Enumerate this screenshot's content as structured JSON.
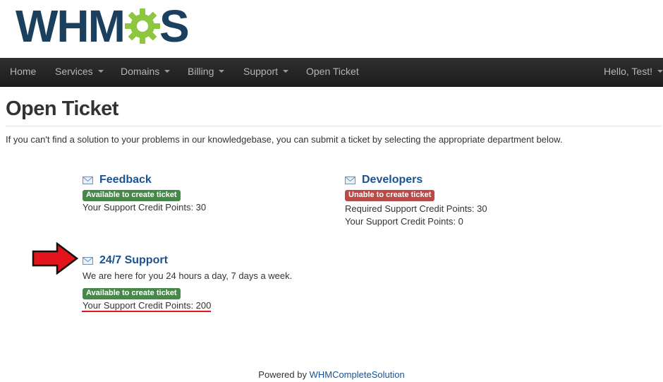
{
  "brand": {
    "logo_text_left": "WHM",
    "logo_text_right": "S",
    "logo_text_color": "#1b3f5e",
    "gear_color": "#8dc63f",
    "gear_icon": "gear-icon"
  },
  "nav": {
    "items": [
      {
        "label": "Home",
        "dropdown": false
      },
      {
        "label": "Services",
        "dropdown": true
      },
      {
        "label": "Domains",
        "dropdown": true
      },
      {
        "label": "Billing",
        "dropdown": true
      },
      {
        "label": "Support",
        "dropdown": true
      },
      {
        "label": "Open Ticket",
        "dropdown": false
      }
    ],
    "user_menu": {
      "label": "Hello, Test!",
      "dropdown": true
    }
  },
  "page": {
    "title": "Open Ticket",
    "intro": "If you can't find a solution to your problems in our knowledgebase, you can submit a ticket by selecting the appropriate department below."
  },
  "departments": [
    {
      "name": "Feedback",
      "icon": "envelope-icon",
      "status": "Available to create ticket",
      "status_color": "#468847",
      "lines": [
        "Your Support Credit Points: 30"
      ]
    },
    {
      "name": "Developers",
      "icon": "envelope-icon",
      "status": "Unable to create ticket",
      "status_color": "#b94a48",
      "lines": [
        "Required Support Credit Points: 30",
        "Your Support Credit Points: 0"
      ]
    },
    {
      "name": "24/7 Support",
      "icon": "envelope-icon",
      "description": "We are here for you 24 hours a day, 7 days a week.",
      "status": "Available to create ticket",
      "status_color": "#468847",
      "lines": [
        "Your Support Credit Points: 200"
      ]
    }
  ],
  "annotations": {
    "arrow_icon": "red-arrow-icon",
    "arrow_color": "#e3141b",
    "underline_color": "#e3141b"
  },
  "footer": {
    "prefix": "Powered by",
    "link": "WHMCompleteSolution"
  }
}
